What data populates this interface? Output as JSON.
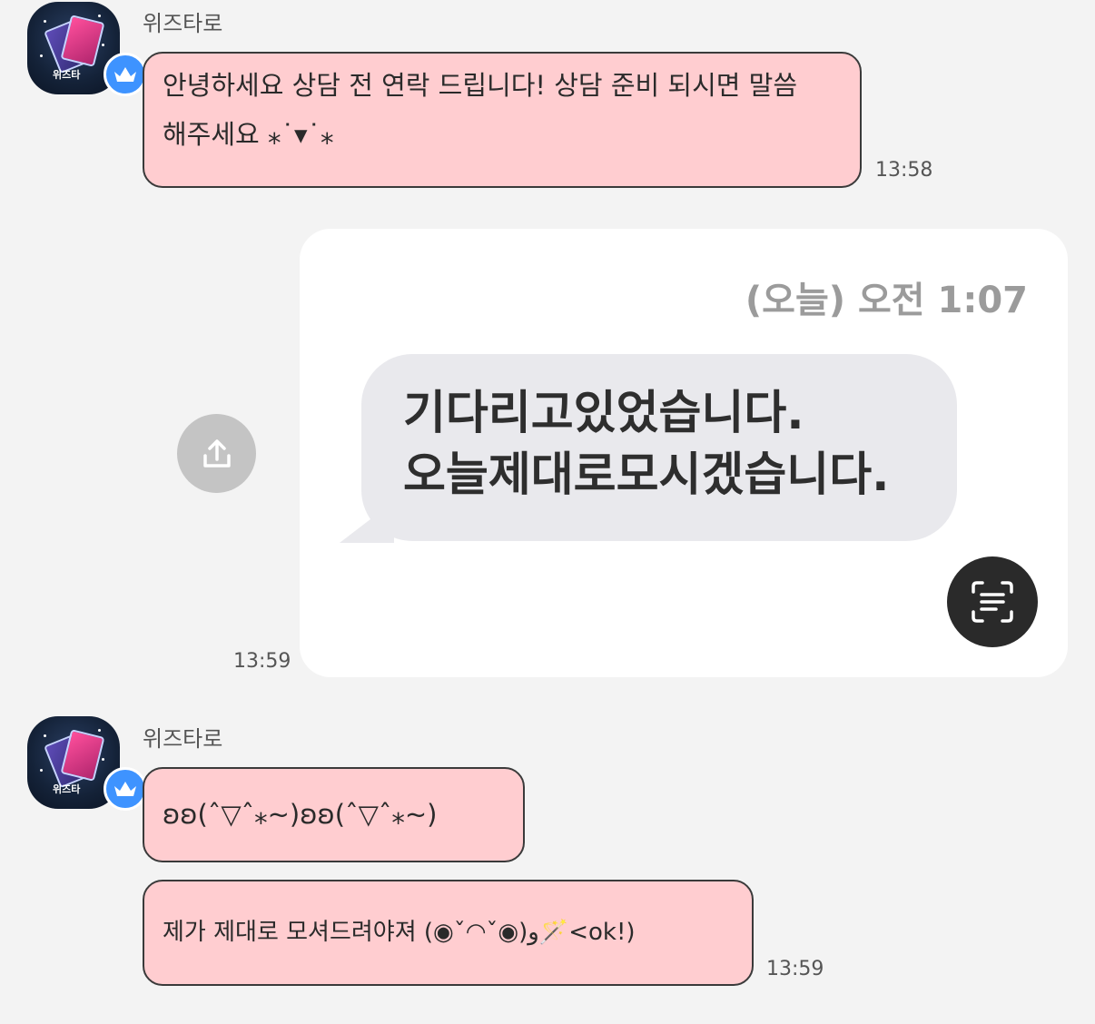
{
  "messages": [
    {
      "sender": "위즈타로",
      "avatar_label": "위즈타",
      "text": "안녕하세요 상담 전 연락 드립니다! 상담 준비 되시면 말씀\n해주세요 ⁎˙▾˙⁎",
      "time": "13:58"
    },
    {
      "image_timestamp": "(오늘) 오전 1:07",
      "image_text": "기다리고있었습니다.\n오늘제대로모시겠습니다.",
      "time": "13:59"
    },
    {
      "sender": "위즈타로",
      "avatar_label": "위즈타",
      "bubbles": [
        "ʚʚ(ˆ▽ˆ⁎~)ʚʚ(ˆ▽ˆ⁎~)",
        "제가 제대로 모셔드려야져 (◉ˇ◠ˇ◉)و🪄<ok!)"
      ],
      "time": "13:59"
    }
  ],
  "icons": {
    "avatar_badge": "crown-icon",
    "share": "share-icon",
    "scan": "text-scan-icon"
  },
  "colors": {
    "background": "#f3f3f3",
    "bubble_fill": "#ffcdd0",
    "badge_blue": "#3e93ff"
  }
}
